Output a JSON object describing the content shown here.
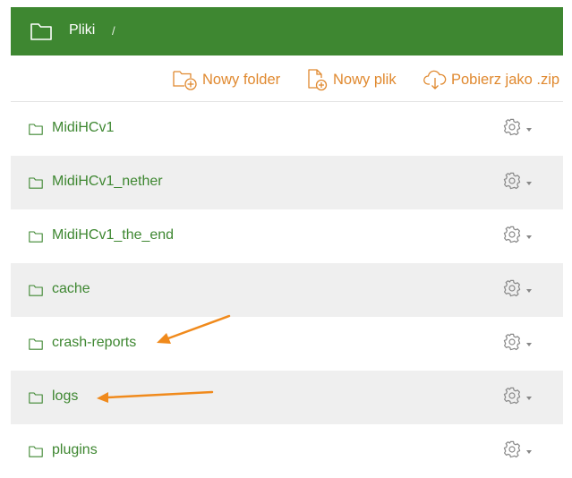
{
  "header": {
    "title": "Pliki",
    "separator": "/"
  },
  "toolbar": {
    "new_folder": "Nowy folder",
    "new_file": "Nowy plik",
    "download_zip": "Pobierz jako .zip"
  },
  "files": [
    {
      "name": "MidiHCv1"
    },
    {
      "name": "MidiHCv1_nether"
    },
    {
      "name": "MidiHCv1_the_end"
    },
    {
      "name": "cache"
    },
    {
      "name": "crash-reports"
    },
    {
      "name": "logs"
    },
    {
      "name": "plugins"
    }
  ],
  "colors": {
    "accent": "#3e8731",
    "action": "#e0892f",
    "annotation": "#f08a1c"
  }
}
